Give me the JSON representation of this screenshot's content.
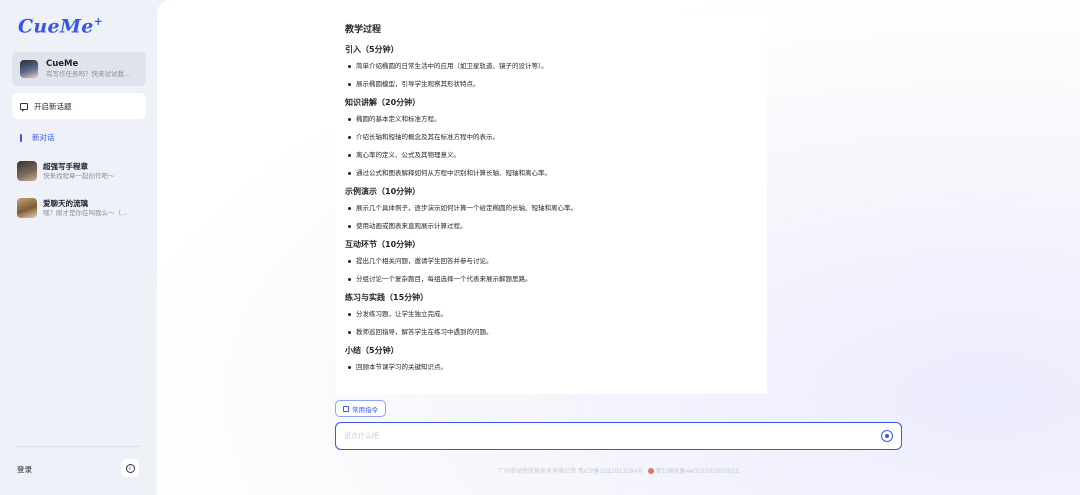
{
  "app": {
    "logo": "CueMe",
    "logo_plus": "+"
  },
  "sidebar": {
    "bot": {
      "name": "CueMe",
      "desc": "有写作任务吗？快来试试我..."
    },
    "new_chat_label": "开启新话题",
    "section_label": "新对话",
    "sessions": [
      {
        "title": "超强写手程章",
        "desc": "快来找程章一起创作吧～"
      },
      {
        "title": "爱聊天的流璃",
        "desc": "嘿？刚才是你在叫我么～（..."
      }
    ],
    "login_label": "登录",
    "info_icon": "info-icon"
  },
  "document": {
    "title": "教学过程",
    "sections": [
      {
        "heading": "引入（5分钟）",
        "bullets": [
          "简单介绍椭圆的日常生活中的应用（如卫星轨道、镜子的设计等）。",
          "展示椭圆模型，引导学生观察其形状特点。"
        ]
      },
      {
        "heading": "知识讲解（20分钟）",
        "bullets": [
          "椭圆的基本定义和标准方程。",
          "介绍长轴和短轴的概念及其在标准方程中的表示。",
          "离心率的定义、公式及其物理意义。",
          "通过公式和图表解释如何从方程中识别和计算长轴、短轴和离心率。"
        ]
      },
      {
        "heading": "示例演示（10分钟）",
        "bullets": [
          "展示几个具体例子，逐步演示如何计算一个给定椭圆的长轴、短轴和离心率。",
          "使用动画或图表来直观展示计算过程。"
        ]
      },
      {
        "heading": "互动环节（10分钟）",
        "bullets": [
          "提出几个相关问题，邀请学生回答并参与讨论。",
          "分组讨论一个复杂题目，每组选择一个代表来展示解题思路。"
        ]
      },
      {
        "heading": "练习与实践（15分钟）",
        "bullets": [
          "分发练习题，让学生独立完成。",
          "教师巡回指导，解答学生在练习中遇到的问题。"
        ]
      },
      {
        "heading": "小结（5分钟）",
        "bullets": [
          "回顾本节课学习的关键知识点。"
        ]
      }
    ]
  },
  "composer": {
    "common_commands_label": "常用指令",
    "input_placeholder": "说点什么吧",
    "input_value": ""
  },
  "footer": {
    "company": "广州市动悦信息技术有限公司 粤ICP备2022013384号",
    "police": "粤公网安备44010502000055"
  },
  "colors": {
    "accent": "#3a56e6",
    "sidebar_bg": "#eef1f7"
  }
}
